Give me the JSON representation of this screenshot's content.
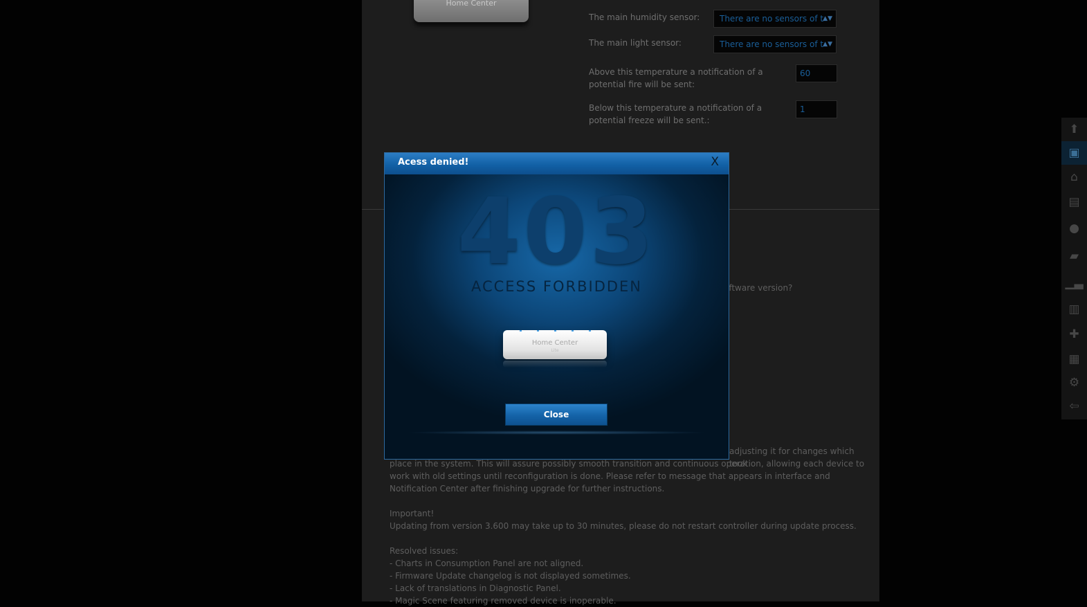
{
  "background_page": {
    "settings": [
      {
        "label": "The main humidity sensor:",
        "value": "There are no sensors of t"
      },
      {
        "label": "The main light sensor:",
        "value": "There are no sensors of t"
      }
    ],
    "fire_label": "Above this temperature a notification of a potential fire will be sent:",
    "fire_value": "60",
    "freeze_label": "Below this temperature a notification of a potential freeze will be sent.:",
    "freeze_value": "1",
    "software_version_fragment": "oftware version?",
    "changelog_fragment_1": "adjusting it for changes which took",
    "changelog_paragraph": "place in the system. This will assure possibly smooth transition and continuous operation, allowing each device to work with old settings until reconfiguration is done. Please refer to message that appears in interface and Notification Center after finishing upgrade for further instructions.",
    "important_heading": "Important!",
    "important_text": "Updating from version 3.600 may take up to 30 minutes, please do not restart controller during update process.",
    "resolved_heading": "Resolved issues:",
    "resolved_items": [
      "- Charts in Consumption Panel are not aligned.",
      "- Firmware Update changelog is not displayed sometimes.",
      "- Lack of translations in Diagnostic Panel.",
      "- Magic Scene featuring removed device is inoperable."
    ],
    "device_logo": "Home Center"
  },
  "side_toolbar": {
    "icons": [
      "arrow-up-icon",
      "save-icon",
      "home-icon",
      "devices-icon",
      "scenes-icon",
      "energy-icon",
      "charts-icon",
      "panels-icon",
      "plugins-icon",
      "schedule-icon",
      "settings-icon",
      "logout-icon"
    ],
    "active_index": 1
  },
  "modal": {
    "title": "Acess denied!",
    "close_x": "X",
    "error_code": "403",
    "error_message": "ACCESS FORBIDDEN",
    "device_label": "Home Center",
    "device_sublabel": "Lite",
    "close_button": "Close"
  }
}
